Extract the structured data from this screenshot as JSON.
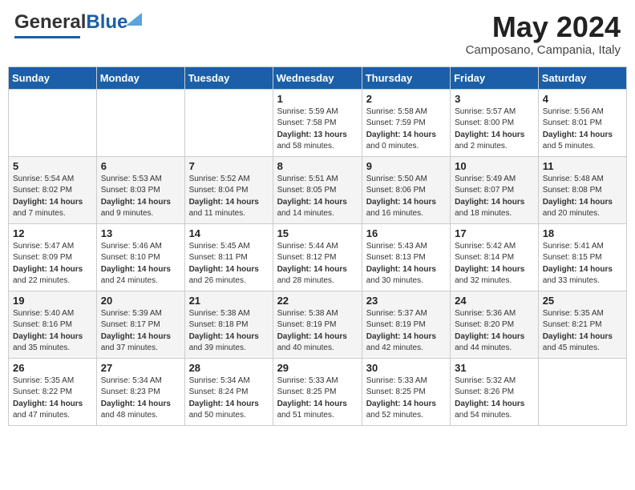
{
  "header": {
    "logo_general": "General",
    "logo_blue": "Blue",
    "month": "May 2024",
    "location": "Camposano, Campania, Italy"
  },
  "weekdays": [
    "Sunday",
    "Monday",
    "Tuesday",
    "Wednesday",
    "Thursday",
    "Friday",
    "Saturday"
  ],
  "weeks": [
    [
      {
        "day": "",
        "info": ""
      },
      {
        "day": "",
        "info": ""
      },
      {
        "day": "",
        "info": ""
      },
      {
        "day": "1",
        "info": "Sunrise: 5:59 AM\nSunset: 7:58 PM\nDaylight: 13 hours\nand 58 minutes."
      },
      {
        "day": "2",
        "info": "Sunrise: 5:58 AM\nSunset: 7:59 PM\nDaylight: 14 hours\nand 0 minutes."
      },
      {
        "day": "3",
        "info": "Sunrise: 5:57 AM\nSunset: 8:00 PM\nDaylight: 14 hours\nand 2 minutes."
      },
      {
        "day": "4",
        "info": "Sunrise: 5:56 AM\nSunset: 8:01 PM\nDaylight: 14 hours\nand 5 minutes."
      }
    ],
    [
      {
        "day": "5",
        "info": "Sunrise: 5:54 AM\nSunset: 8:02 PM\nDaylight: 14 hours\nand 7 minutes."
      },
      {
        "day": "6",
        "info": "Sunrise: 5:53 AM\nSunset: 8:03 PM\nDaylight: 14 hours\nand 9 minutes."
      },
      {
        "day": "7",
        "info": "Sunrise: 5:52 AM\nSunset: 8:04 PM\nDaylight: 14 hours\nand 11 minutes."
      },
      {
        "day": "8",
        "info": "Sunrise: 5:51 AM\nSunset: 8:05 PM\nDaylight: 14 hours\nand 14 minutes."
      },
      {
        "day": "9",
        "info": "Sunrise: 5:50 AM\nSunset: 8:06 PM\nDaylight: 14 hours\nand 16 minutes."
      },
      {
        "day": "10",
        "info": "Sunrise: 5:49 AM\nSunset: 8:07 PM\nDaylight: 14 hours\nand 18 minutes."
      },
      {
        "day": "11",
        "info": "Sunrise: 5:48 AM\nSunset: 8:08 PM\nDaylight: 14 hours\nand 20 minutes."
      }
    ],
    [
      {
        "day": "12",
        "info": "Sunrise: 5:47 AM\nSunset: 8:09 PM\nDaylight: 14 hours\nand 22 minutes."
      },
      {
        "day": "13",
        "info": "Sunrise: 5:46 AM\nSunset: 8:10 PM\nDaylight: 14 hours\nand 24 minutes."
      },
      {
        "day": "14",
        "info": "Sunrise: 5:45 AM\nSunset: 8:11 PM\nDaylight: 14 hours\nand 26 minutes."
      },
      {
        "day": "15",
        "info": "Sunrise: 5:44 AM\nSunset: 8:12 PM\nDaylight: 14 hours\nand 28 minutes."
      },
      {
        "day": "16",
        "info": "Sunrise: 5:43 AM\nSunset: 8:13 PM\nDaylight: 14 hours\nand 30 minutes."
      },
      {
        "day": "17",
        "info": "Sunrise: 5:42 AM\nSunset: 8:14 PM\nDaylight: 14 hours\nand 32 minutes."
      },
      {
        "day": "18",
        "info": "Sunrise: 5:41 AM\nSunset: 8:15 PM\nDaylight: 14 hours\nand 33 minutes."
      }
    ],
    [
      {
        "day": "19",
        "info": "Sunrise: 5:40 AM\nSunset: 8:16 PM\nDaylight: 14 hours\nand 35 minutes."
      },
      {
        "day": "20",
        "info": "Sunrise: 5:39 AM\nSunset: 8:17 PM\nDaylight: 14 hours\nand 37 minutes."
      },
      {
        "day": "21",
        "info": "Sunrise: 5:38 AM\nSunset: 8:18 PM\nDaylight: 14 hours\nand 39 minutes."
      },
      {
        "day": "22",
        "info": "Sunrise: 5:38 AM\nSunset: 8:19 PM\nDaylight: 14 hours\nand 40 minutes."
      },
      {
        "day": "23",
        "info": "Sunrise: 5:37 AM\nSunset: 8:19 PM\nDaylight: 14 hours\nand 42 minutes."
      },
      {
        "day": "24",
        "info": "Sunrise: 5:36 AM\nSunset: 8:20 PM\nDaylight: 14 hours\nand 44 minutes."
      },
      {
        "day": "25",
        "info": "Sunrise: 5:35 AM\nSunset: 8:21 PM\nDaylight: 14 hours\nand 45 minutes."
      }
    ],
    [
      {
        "day": "26",
        "info": "Sunrise: 5:35 AM\nSunset: 8:22 PM\nDaylight: 14 hours\nand 47 minutes."
      },
      {
        "day": "27",
        "info": "Sunrise: 5:34 AM\nSunset: 8:23 PM\nDaylight: 14 hours\nand 48 minutes."
      },
      {
        "day": "28",
        "info": "Sunrise: 5:34 AM\nSunset: 8:24 PM\nDaylight: 14 hours\nand 50 minutes."
      },
      {
        "day": "29",
        "info": "Sunrise: 5:33 AM\nSunset: 8:25 PM\nDaylight: 14 hours\nand 51 minutes."
      },
      {
        "day": "30",
        "info": "Sunrise: 5:33 AM\nSunset: 8:25 PM\nDaylight: 14 hours\nand 52 minutes."
      },
      {
        "day": "31",
        "info": "Sunrise: 5:32 AM\nSunset: 8:26 PM\nDaylight: 14 hours\nand 54 minutes."
      },
      {
        "day": "",
        "info": ""
      }
    ]
  ]
}
